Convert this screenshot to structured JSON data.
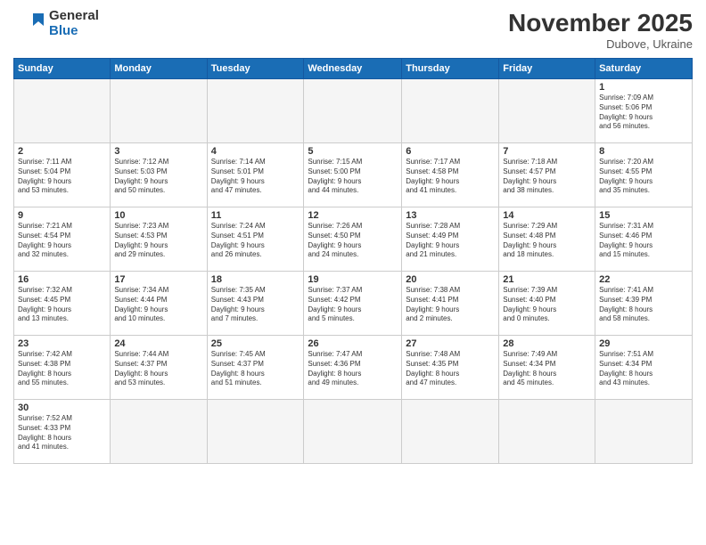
{
  "header": {
    "logo_general": "General",
    "logo_blue": "Blue",
    "month_title": "November 2025",
    "location": "Dubove, Ukraine"
  },
  "weekdays": [
    "Sunday",
    "Monday",
    "Tuesday",
    "Wednesday",
    "Thursday",
    "Friday",
    "Saturday"
  ],
  "weeks": [
    [
      {
        "day": "",
        "info": ""
      },
      {
        "day": "",
        "info": ""
      },
      {
        "day": "",
        "info": ""
      },
      {
        "day": "",
        "info": ""
      },
      {
        "day": "",
        "info": ""
      },
      {
        "day": "",
        "info": ""
      },
      {
        "day": "1",
        "info": "Sunrise: 7:09 AM\nSunset: 5:06 PM\nDaylight: 9 hours\nand 56 minutes."
      }
    ],
    [
      {
        "day": "2",
        "info": "Sunrise: 7:11 AM\nSunset: 5:04 PM\nDaylight: 9 hours\nand 53 minutes."
      },
      {
        "day": "3",
        "info": "Sunrise: 7:12 AM\nSunset: 5:03 PM\nDaylight: 9 hours\nand 50 minutes."
      },
      {
        "day": "4",
        "info": "Sunrise: 7:14 AM\nSunset: 5:01 PM\nDaylight: 9 hours\nand 47 minutes."
      },
      {
        "day": "5",
        "info": "Sunrise: 7:15 AM\nSunset: 5:00 PM\nDaylight: 9 hours\nand 44 minutes."
      },
      {
        "day": "6",
        "info": "Sunrise: 7:17 AM\nSunset: 4:58 PM\nDaylight: 9 hours\nand 41 minutes."
      },
      {
        "day": "7",
        "info": "Sunrise: 7:18 AM\nSunset: 4:57 PM\nDaylight: 9 hours\nand 38 minutes."
      },
      {
        "day": "8",
        "info": "Sunrise: 7:20 AM\nSunset: 4:55 PM\nDaylight: 9 hours\nand 35 minutes."
      }
    ],
    [
      {
        "day": "9",
        "info": "Sunrise: 7:21 AM\nSunset: 4:54 PM\nDaylight: 9 hours\nand 32 minutes."
      },
      {
        "day": "10",
        "info": "Sunrise: 7:23 AM\nSunset: 4:53 PM\nDaylight: 9 hours\nand 29 minutes."
      },
      {
        "day": "11",
        "info": "Sunrise: 7:24 AM\nSunset: 4:51 PM\nDaylight: 9 hours\nand 26 minutes."
      },
      {
        "day": "12",
        "info": "Sunrise: 7:26 AM\nSunset: 4:50 PM\nDaylight: 9 hours\nand 24 minutes."
      },
      {
        "day": "13",
        "info": "Sunrise: 7:28 AM\nSunset: 4:49 PM\nDaylight: 9 hours\nand 21 minutes."
      },
      {
        "day": "14",
        "info": "Sunrise: 7:29 AM\nSunset: 4:48 PM\nDaylight: 9 hours\nand 18 minutes."
      },
      {
        "day": "15",
        "info": "Sunrise: 7:31 AM\nSunset: 4:46 PM\nDaylight: 9 hours\nand 15 minutes."
      }
    ],
    [
      {
        "day": "16",
        "info": "Sunrise: 7:32 AM\nSunset: 4:45 PM\nDaylight: 9 hours\nand 13 minutes."
      },
      {
        "day": "17",
        "info": "Sunrise: 7:34 AM\nSunset: 4:44 PM\nDaylight: 9 hours\nand 10 minutes."
      },
      {
        "day": "18",
        "info": "Sunrise: 7:35 AM\nSunset: 4:43 PM\nDaylight: 9 hours\nand 7 minutes."
      },
      {
        "day": "19",
        "info": "Sunrise: 7:37 AM\nSunset: 4:42 PM\nDaylight: 9 hours\nand 5 minutes."
      },
      {
        "day": "20",
        "info": "Sunrise: 7:38 AM\nSunset: 4:41 PM\nDaylight: 9 hours\nand 2 minutes."
      },
      {
        "day": "21",
        "info": "Sunrise: 7:39 AM\nSunset: 4:40 PM\nDaylight: 9 hours\nand 0 minutes."
      },
      {
        "day": "22",
        "info": "Sunrise: 7:41 AM\nSunset: 4:39 PM\nDaylight: 8 hours\nand 58 minutes."
      }
    ],
    [
      {
        "day": "23",
        "info": "Sunrise: 7:42 AM\nSunset: 4:38 PM\nDaylight: 8 hours\nand 55 minutes."
      },
      {
        "day": "24",
        "info": "Sunrise: 7:44 AM\nSunset: 4:37 PM\nDaylight: 8 hours\nand 53 minutes."
      },
      {
        "day": "25",
        "info": "Sunrise: 7:45 AM\nSunset: 4:37 PM\nDaylight: 8 hours\nand 51 minutes."
      },
      {
        "day": "26",
        "info": "Sunrise: 7:47 AM\nSunset: 4:36 PM\nDaylight: 8 hours\nand 49 minutes."
      },
      {
        "day": "27",
        "info": "Sunrise: 7:48 AM\nSunset: 4:35 PM\nDaylight: 8 hours\nand 47 minutes."
      },
      {
        "day": "28",
        "info": "Sunrise: 7:49 AM\nSunset: 4:34 PM\nDaylight: 8 hours\nand 45 minutes."
      },
      {
        "day": "29",
        "info": "Sunrise: 7:51 AM\nSunset: 4:34 PM\nDaylight: 8 hours\nand 43 minutes."
      }
    ],
    [
      {
        "day": "30",
        "info": "Sunrise: 7:52 AM\nSunset: 4:33 PM\nDaylight: 8 hours\nand 41 minutes."
      },
      {
        "day": "",
        "info": ""
      },
      {
        "day": "",
        "info": ""
      },
      {
        "day": "",
        "info": ""
      },
      {
        "day": "",
        "info": ""
      },
      {
        "day": "",
        "info": ""
      },
      {
        "day": "",
        "info": ""
      }
    ]
  ]
}
